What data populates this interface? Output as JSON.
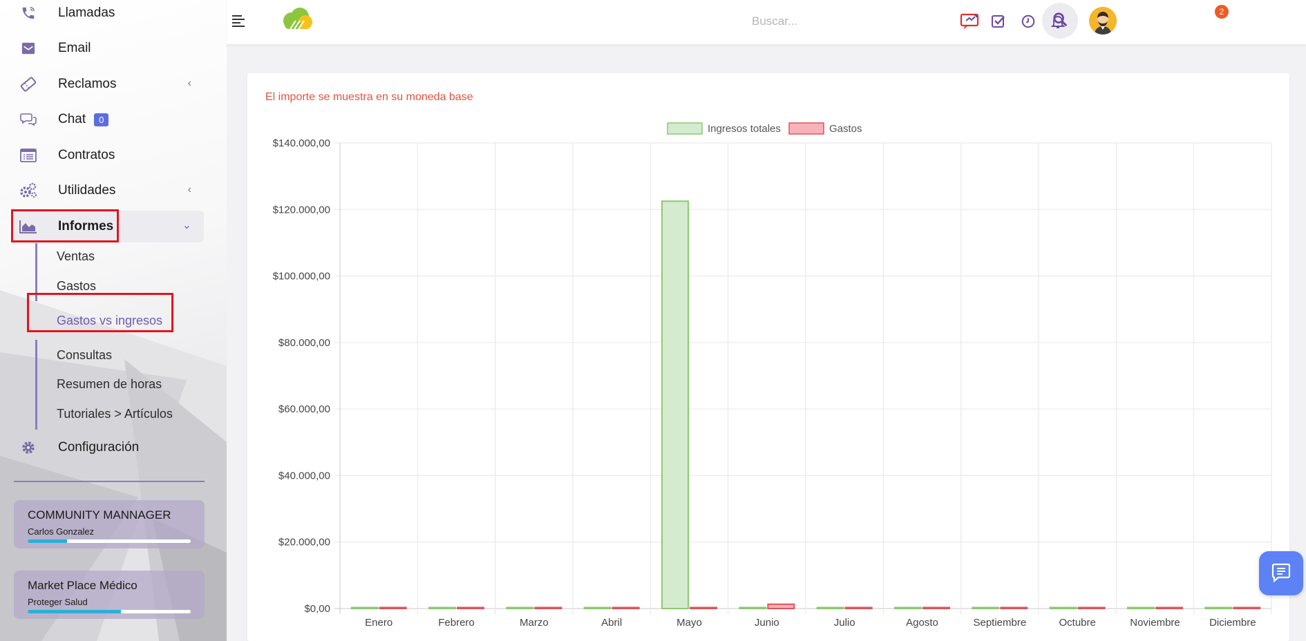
{
  "sidebar": {
    "items": [
      {
        "label": "Llamadas",
        "icon": "phone-icon"
      },
      {
        "label": "Email",
        "icon": "envelope-icon"
      },
      {
        "label": "Reclamos",
        "icon": "ticket-icon"
      },
      {
        "label": "Chat",
        "icon": "chat-bubbles-icon",
        "badge": "0"
      },
      {
        "label": "Contratos",
        "icon": "contract-list-icon"
      },
      {
        "label": "Utilidades",
        "icon": "gears-icon"
      },
      {
        "label": "Informes",
        "icon": "area-chart-icon"
      },
      {
        "label": "Configuración",
        "icon": "gear-icon"
      }
    ],
    "submenu": [
      {
        "label": "Ventas"
      },
      {
        "label": "Gastos"
      },
      {
        "label": "Gastos vs ingresos"
      },
      {
        "label": "Consultas"
      },
      {
        "label": "Resumen de horas"
      },
      {
        "label": "Tutoriales > Artículos"
      }
    ],
    "cards": [
      {
        "title": "COMMUNITY MANNAGER",
        "subtitle": "Carlos Gonzalez",
        "progress": 0.24
      },
      {
        "title": "Market Place Médico",
        "subtitle": "Proteger Salud",
        "progress": 0.57
      }
    ]
  },
  "header": {
    "search_placeholder": "Buscar...",
    "tasks_badge": "2"
  },
  "main": {
    "note": "El importe se muestra en su moneda base"
  },
  "colors": {
    "accent": "#6b5cb0",
    "income_fill": "#d4ebcf",
    "income_stroke": "#8cc96f",
    "expense_fill": "#f7b3b8",
    "expense_stroke": "#e0535c",
    "highlight": "#e2141e"
  },
  "chart_data": {
    "type": "bar",
    "categories": [
      "Enero",
      "Febrero",
      "Marzo",
      "Abril",
      "Mayo",
      "Junio",
      "Julio",
      "Agosto",
      "Septiembre",
      "Octubre",
      "Noviembre",
      "Diciembre"
    ],
    "series": [
      {
        "name": "Ingresos totales",
        "values": [
          0,
          0,
          0,
          0,
          122500,
          0,
          0,
          0,
          0,
          0,
          0,
          0
        ]
      },
      {
        "name": "Gastos",
        "values": [
          0,
          0,
          0,
          0,
          0,
          1300,
          0,
          0,
          0,
          0,
          0,
          0
        ]
      }
    ],
    "y_ticks": [
      "$0,00",
      "$20.000,00",
      "$40.000,00",
      "$60.000,00",
      "$80.000,00",
      "$100.000,00",
      "$120.000,00",
      "$140.000,00"
    ],
    "ylim": [
      0,
      140000
    ],
    "grid": true,
    "legend_position": "top-center"
  }
}
